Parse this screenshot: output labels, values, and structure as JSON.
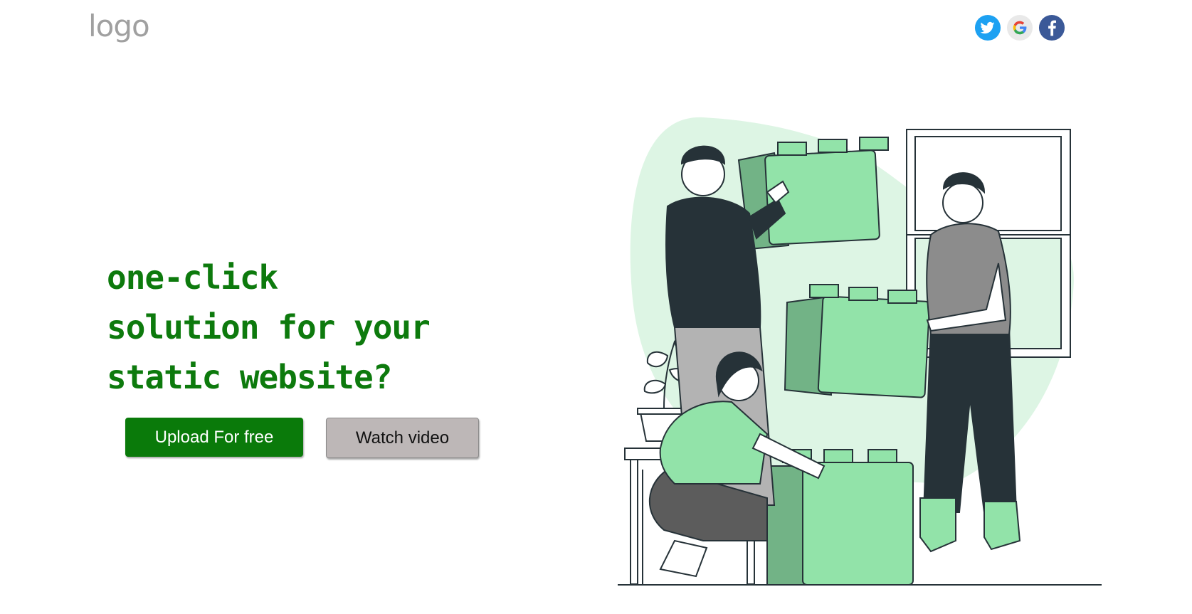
{
  "header": {
    "logo_text": "logo",
    "social": [
      {
        "name": "twitter",
        "icon": "twitter-icon",
        "color": "#1DA1F2"
      },
      {
        "name": "google",
        "icon": "google-icon",
        "color": "#4285F4"
      },
      {
        "name": "facebook",
        "icon": "facebook-icon",
        "color": "#3B5998"
      }
    ]
  },
  "hero": {
    "headline_lines": [
      "one-click",
      "solution for your",
      "static website?"
    ],
    "color": "#0D7A0D"
  },
  "buttons": {
    "upload_label": "Upload For free",
    "watch_label": "Watch video"
  },
  "colors": {
    "accent_green": "#0A7A0A",
    "block_green": "#92E3A9",
    "dark": "#263238",
    "secondary_button": "#BDB7B7"
  }
}
